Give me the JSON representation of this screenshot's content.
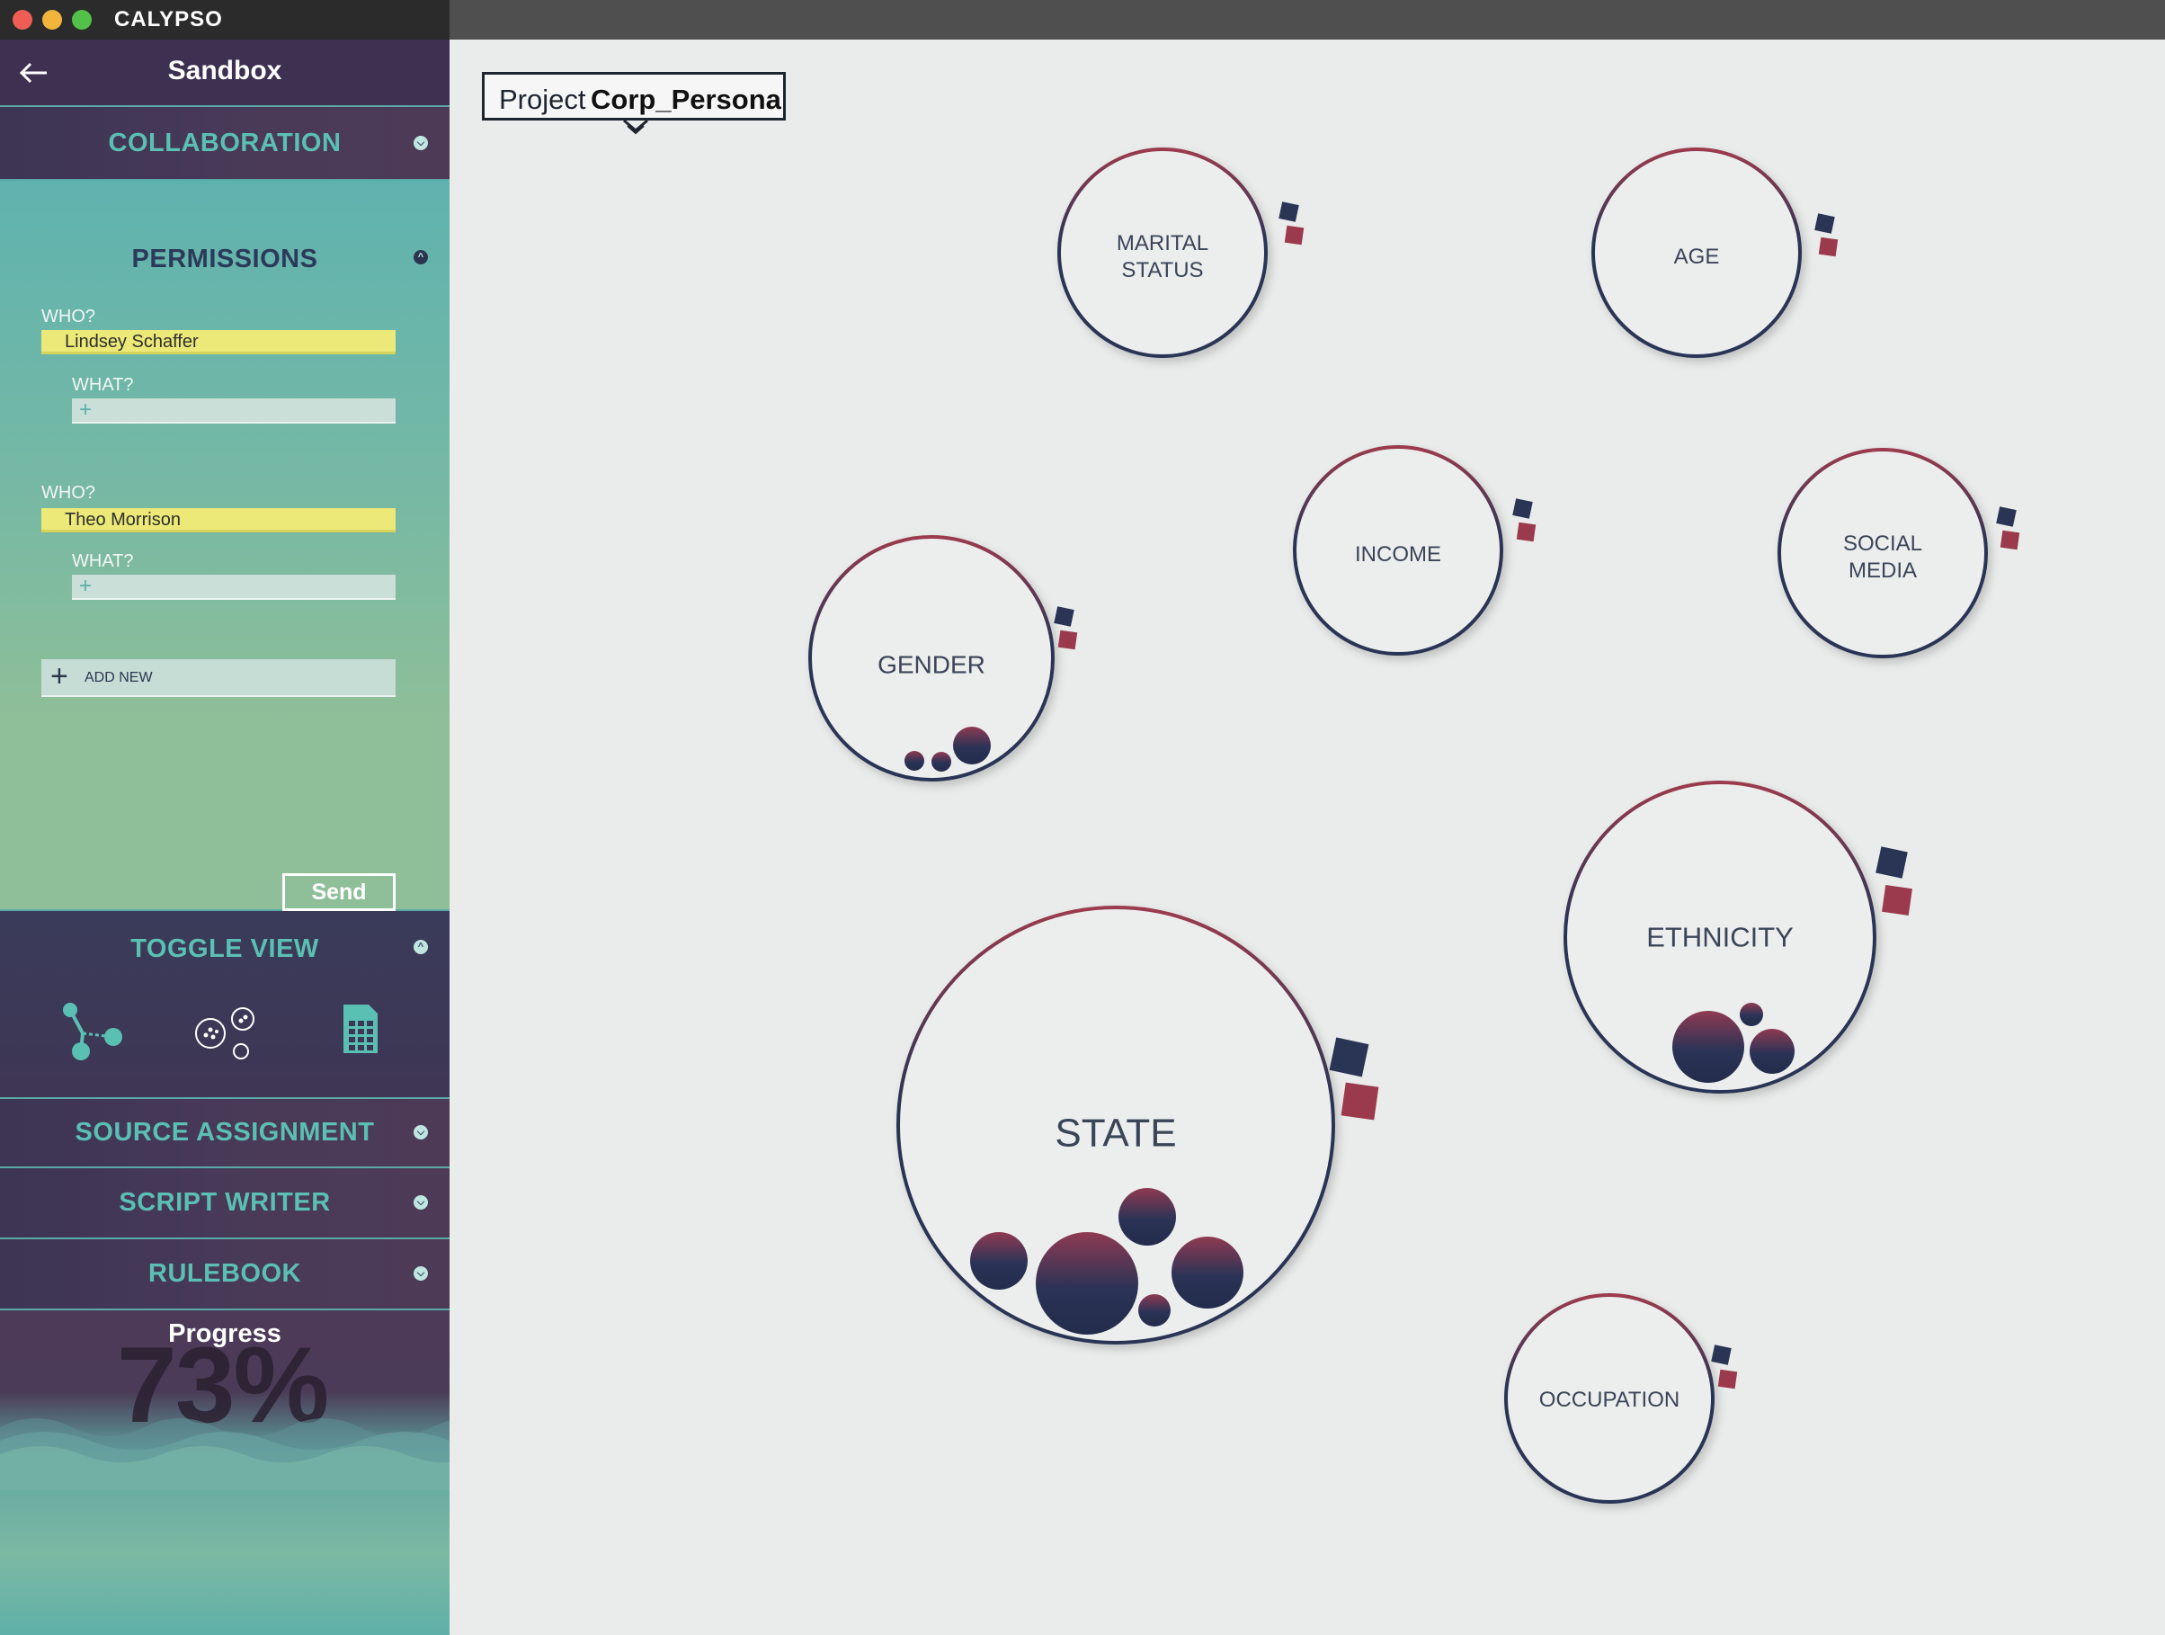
{
  "app": {
    "title": "CALYPSO",
    "traffic_lights": [
      "#ee5e55",
      "#f2b53c",
      "#53c149"
    ]
  },
  "sidebar": {
    "back_icon": "arrow-left-icon",
    "header_title": "Sandbox",
    "collaboration_label": "COLLABORATION",
    "permissions": {
      "label": "PERMISSIONS",
      "entries": [
        {
          "who_label": "WHO?",
          "who_value": "Lindsey Schaffer",
          "what_label": "WHAT?",
          "what_placeholder": "+"
        },
        {
          "who_label": "WHO?",
          "who_value": "Theo Morrison",
          "what_label": "WHAT?",
          "what_placeholder": "+"
        }
      ],
      "add_new_label": "ADD NEW",
      "send_label": "Send"
    },
    "toggle_view": {
      "label": "TOGGLE VIEW",
      "icons": [
        "network-graph-icon",
        "bubble-cluster-icon",
        "spreadsheet-icon"
      ]
    },
    "source_assignment_label": "SOURCE ASSIGNMENT",
    "script_writer_label": "SCRIPT WRITER",
    "rulebook_label": "RULEBOOK",
    "progress": {
      "label": "Progress",
      "value_text": "73%",
      "value": 0.73
    }
  },
  "canvas": {
    "project_prefix": "Project",
    "project_name": "Corp_Persona",
    "nodes": [
      {
        "id": "marital",
        "lines": [
          "MARITAL",
          "STATUS"
        ]
      },
      {
        "id": "age",
        "lines": [
          "AGE"
        ]
      },
      {
        "id": "income",
        "lines": [
          "INCOME"
        ]
      },
      {
        "id": "social",
        "lines": [
          "SOCIAL",
          "MEDIA"
        ]
      },
      {
        "id": "gender",
        "lines": [
          "GENDER"
        ]
      },
      {
        "id": "ethnicity",
        "lines": [
          "ETHNICITY"
        ]
      },
      {
        "id": "state",
        "lines": [
          "STATE"
        ]
      },
      {
        "id": "occupation",
        "lines": [
          "OCCUPATION"
        ]
      }
    ]
  },
  "colors": {
    "accent_teal": "#5bc0b4",
    "node_navy": "#2a3556",
    "node_red": "#9c3a4d",
    "highlight_yellow": "#ece978"
  }
}
